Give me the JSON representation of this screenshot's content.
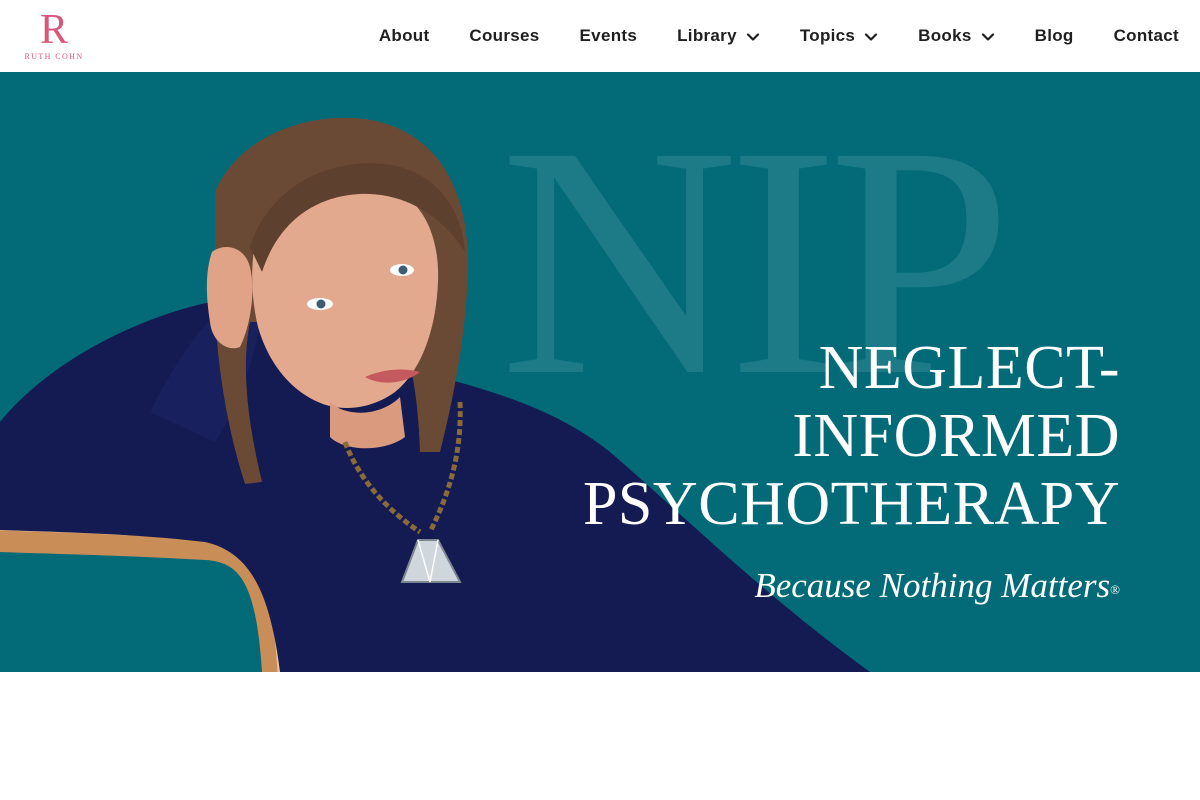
{
  "colors": {
    "teal": "#036a77",
    "monogram": "#1d7a87",
    "brand": "#d9577a",
    "nav": "#1f1f1f",
    "sweater": "#141a52",
    "chair": "#c98e57",
    "skin": "#e3a98e",
    "hair": "#6b4a35"
  },
  "logo": {
    "mark": "R",
    "text": "RUTH COHN"
  },
  "nav": {
    "items": [
      {
        "label": "About",
        "has_dropdown": false
      },
      {
        "label": "Courses",
        "has_dropdown": false
      },
      {
        "label": "Events",
        "has_dropdown": false
      },
      {
        "label": "Library",
        "has_dropdown": true
      },
      {
        "label": "Topics",
        "has_dropdown": true
      },
      {
        "label": "Books",
        "has_dropdown": true
      },
      {
        "label": "Blog",
        "has_dropdown": false
      },
      {
        "label": "Contact",
        "has_dropdown": false
      }
    ],
    "dropdown_icon": "chevron-down-icon"
  },
  "hero": {
    "monogram": "NIP",
    "title_lines": [
      "NEGLECT-",
      "INFORMED",
      "PSYCHOTHERAPY"
    ],
    "tagline": "Because Nothing Matters",
    "tagline_mark": "®",
    "photo": "portrait-photo"
  }
}
